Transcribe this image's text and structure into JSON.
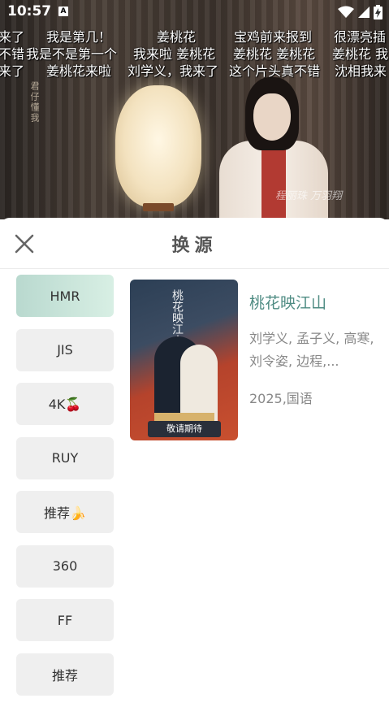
{
  "status_bar": {
    "time": "10:57"
  },
  "danmaku": [
    {
      "text": "来了"
    },
    {
      "text": "我是第几！"
    },
    {
      "text": "姜桃花"
    },
    {
      "text": "宝鸡前来报到"
    },
    {
      "text": "很漂亮插"
    },
    {
      "text": "不错"
    },
    {
      "text": "我是不是第一个"
    },
    {
      "text": "我来啦 姜桃花"
    },
    {
      "text": "姜桃花 姜桃花"
    },
    {
      "text": "姜桃花 我"
    },
    {
      "text": "来了"
    },
    {
      "text": "姜桃花来啦"
    },
    {
      "text": "刘学义，我来了"
    },
    {
      "text": "这个片头真不错"
    },
    {
      "text": "沈相我来"
    }
  ],
  "video_overlay": {
    "credit": "程丽珠  万羽翔"
  },
  "sheet": {
    "title": "换源",
    "sources": [
      "HMR",
      "JIS",
      "4K🍒",
      "RUY",
      "推荐🍌",
      "360",
      "FF",
      "推荐"
    ],
    "active_index": 0
  },
  "result": {
    "title": "桃花映江山",
    "cast": "刘学义, 孟子义, 高寒, 刘令姿, 边程,...",
    "meta": "2025,国语",
    "poster_tag": "敬请期待",
    "poster_title": "桃花映江山"
  },
  "colors": {
    "accent": "#4f8c83",
    "active_source_bg": "#c6e4d8"
  }
}
